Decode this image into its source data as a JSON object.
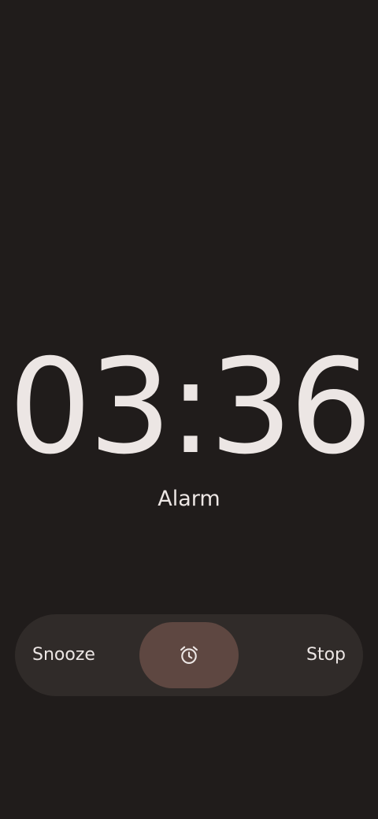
{
  "alarm": {
    "time": "03:36",
    "label": "Alarm"
  },
  "actions": {
    "snooze_label": "Snooze",
    "stop_label": "Stop",
    "handle_icon": "alarm-clock-icon"
  },
  "colors": {
    "background": "#201c1b",
    "slider_track": "#302b29",
    "handle": "#5e4741",
    "text": "#ece6e4"
  }
}
